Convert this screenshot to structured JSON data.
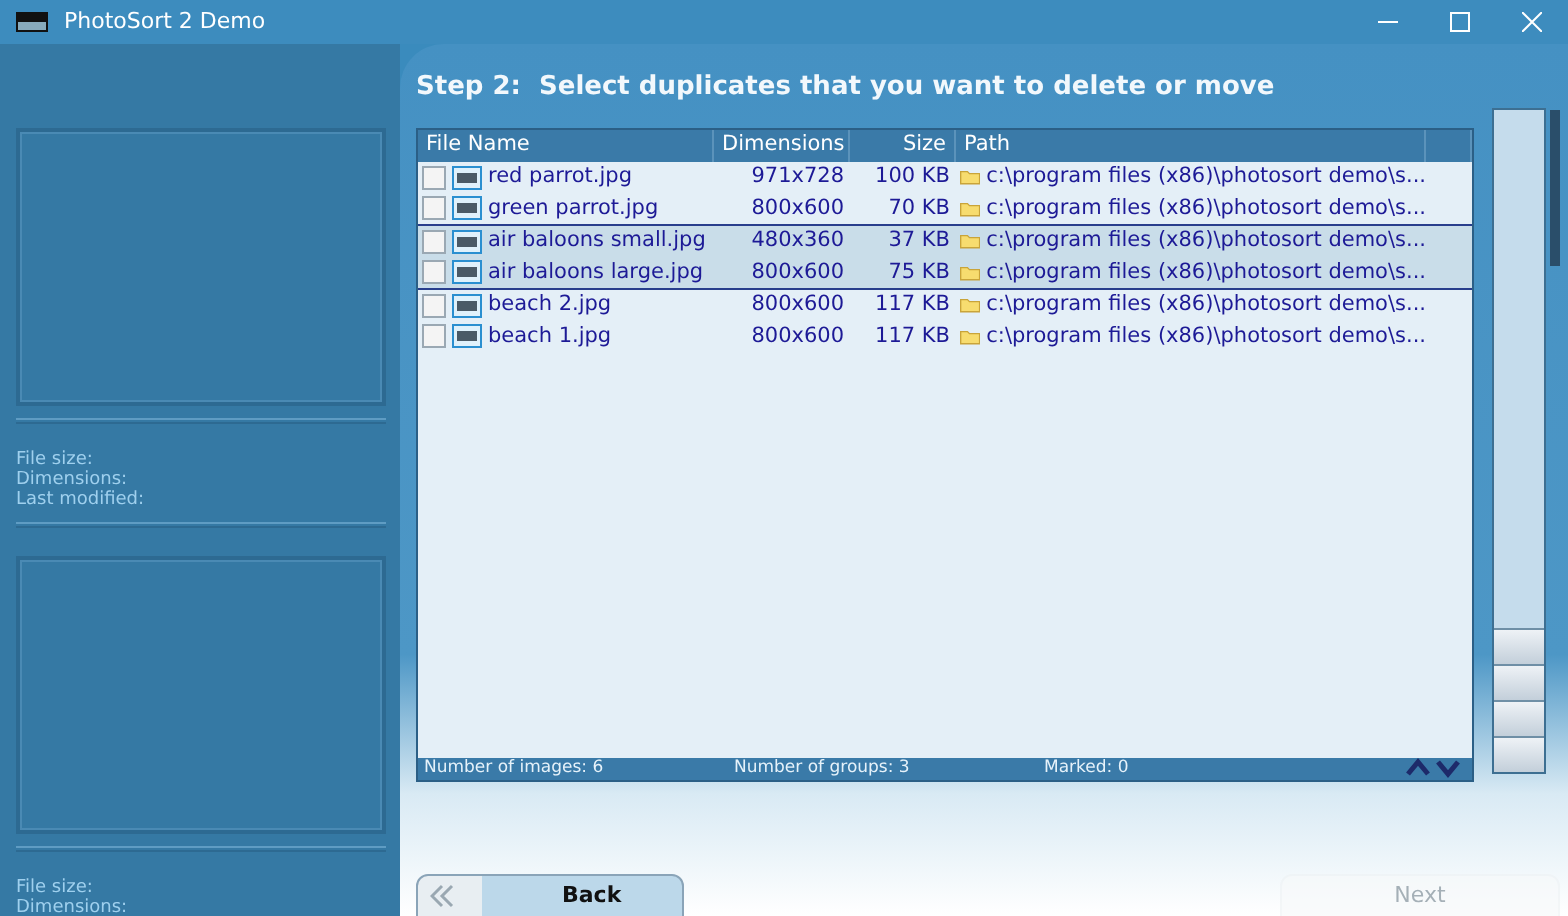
{
  "window": {
    "title": "PhotoSort 2 Demo"
  },
  "left_panel": {
    "previews": [
      {
        "labels": [
          "File size:",
          "Dimensions:",
          "Last modified:"
        ]
      },
      {
        "labels": [
          "File size:",
          "Dimensions:"
        ]
      }
    ]
  },
  "step_title": "Step 2:  Select duplicates that you want to delete or move",
  "table": {
    "columns": [
      "File Name",
      "Dimensions",
      "Size",
      "Path"
    ],
    "groups": [
      {
        "highlighted": false,
        "rows": [
          {
            "checked": false,
            "name": "red parrot.jpg",
            "dimensions": "971x728",
            "size": "100 KB",
            "path": "c:\\program files (x86)\\photosort demo\\s..."
          },
          {
            "checked": false,
            "name": "green parrot.jpg",
            "dimensions": "800x600",
            "size": "70 KB",
            "path": "c:\\program files (x86)\\photosort demo\\s..."
          }
        ]
      },
      {
        "highlighted": true,
        "rows": [
          {
            "checked": false,
            "name": "air baloons small.jpg",
            "dimensions": "480x360",
            "size": "37 KB",
            "path": "c:\\program files (x86)\\photosort demo\\s..."
          },
          {
            "checked": false,
            "name": "air baloons large.jpg",
            "dimensions": "800x600",
            "size": "75 KB",
            "path": "c:\\program files (x86)\\photosort demo\\s..."
          }
        ]
      },
      {
        "highlighted": false,
        "rows": [
          {
            "checked": false,
            "name": "beach 2.jpg",
            "dimensions": "800x600",
            "size": "117 KB",
            "path": "c:\\program files (x86)\\photosort demo\\s..."
          },
          {
            "checked": false,
            "name": "beach 1.jpg",
            "dimensions": "800x600",
            "size": "117 KB",
            "path": "c:\\program files (x86)\\photosort demo\\s..."
          }
        ]
      }
    ]
  },
  "status": {
    "images": "Number of images: 6",
    "groups": "Number of groups: 3",
    "marked": "Marked: 0"
  },
  "buttons": [
    {
      "label": "Back",
      "disabled": false
    },
    {
      "label": "Next",
      "disabled": true
    }
  ]
}
